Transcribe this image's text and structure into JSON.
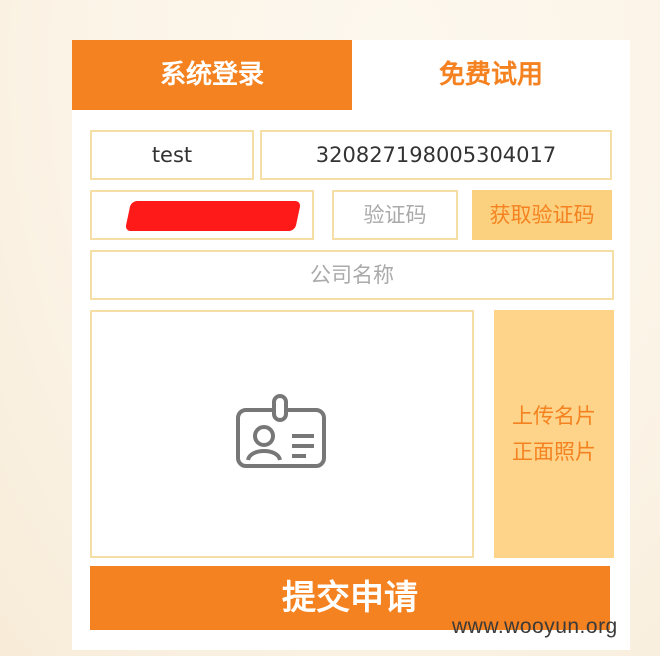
{
  "tabs": {
    "login_label": "系统登录",
    "trial_label": "免费试用"
  },
  "form": {
    "name_value": "test",
    "id_number_value": "320827198005304017",
    "phone_value": "",
    "code_placeholder": "验证码",
    "get_code_label": "获取验证码",
    "company_placeholder": "公司名称",
    "upload_line1": "上传名片",
    "upload_line2": "正面照片",
    "submit_label": "提交申请"
  },
  "icons": {
    "card": "id-card-icon"
  },
  "colors": {
    "accent": "#f58220",
    "light_accent": "#fbd07e",
    "border": "#f6dfa6",
    "redaction": "#ff1a1a"
  },
  "watermark": "www.wooyun.org"
}
